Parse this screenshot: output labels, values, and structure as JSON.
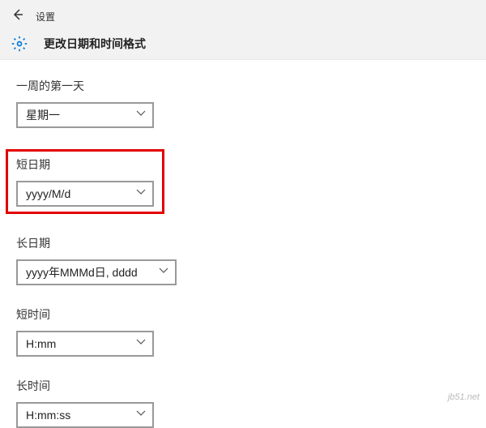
{
  "header": {
    "app_title": "设置",
    "page_title": "更改日期和时间格式"
  },
  "fields": {
    "first_day_of_week": {
      "label": "一周的第一天",
      "value": "星期一"
    },
    "short_date": {
      "label": "短日期",
      "value": "yyyy/M/d"
    },
    "long_date": {
      "label": "长日期",
      "value": "yyyy年MMMd日, dddd"
    },
    "short_time": {
      "label": "短时间",
      "value": "H:mm"
    },
    "long_time": {
      "label": "长时间",
      "value": "H:mm:ss"
    }
  },
  "watermark": "jb51.net"
}
